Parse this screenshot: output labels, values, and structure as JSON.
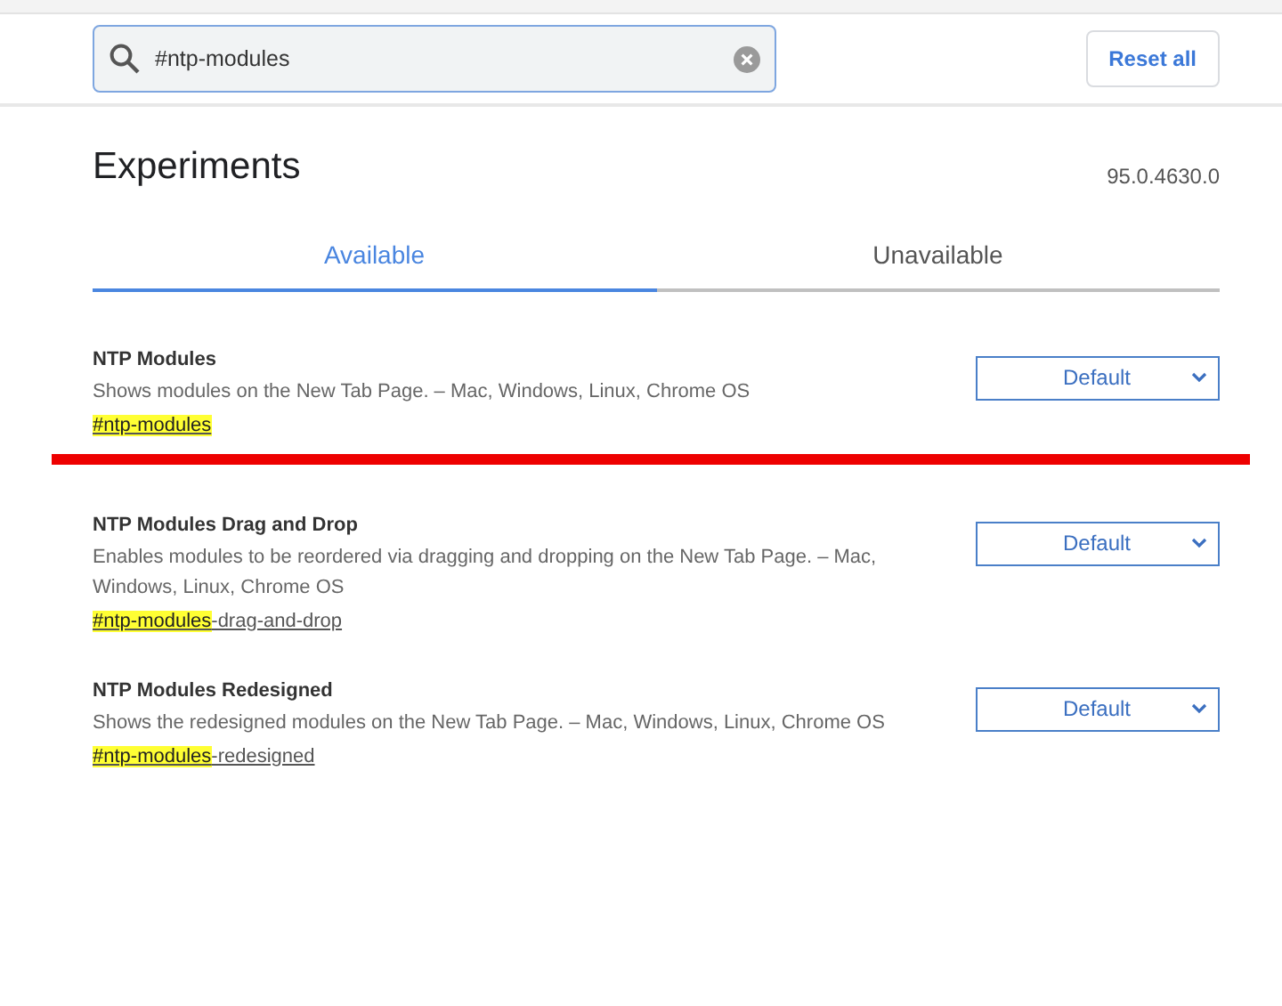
{
  "search": {
    "value": "#ntp-modules"
  },
  "reset_button": "Reset all",
  "title": "Experiments",
  "version": "95.0.4630.0",
  "tabs": [
    {
      "label": "Available",
      "selected": true
    },
    {
      "label": "Unavailable",
      "selected": false
    }
  ],
  "experiments": [
    {
      "name": "NTP Modules",
      "description": "Shows modules on the New Tab Page. – Mac, Windows, Linux, Chrome OS",
      "link_match": "#ntp-modules",
      "select": "Default",
      "red_underline": true
    },
    {
      "name": "NTP Modules Drag and Drop",
      "description": "Enables modules to be reordered via dragging and dropping on the New Tab Page. – Mac, Windows, Linux, Chrome OS",
      "link_match": "#ntp-modules",
      "link_rest": "-drag-and-drop",
      "select": "Default",
      "red_underline": false
    },
    {
      "name": "NTP Modules Redesigned",
      "description": "Shows the redesigned modules on the New Tab Page. – Mac, Windows, Linux, Chrome OS",
      "link_match": "#ntp-modules",
      "link_rest": "-redesigned",
      "select": "Default",
      "red_underline": false
    }
  ]
}
